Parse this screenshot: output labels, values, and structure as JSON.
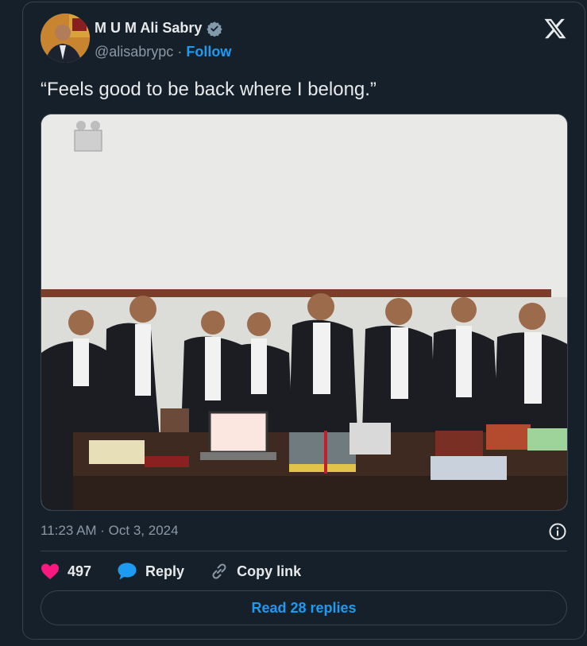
{
  "author": {
    "name": "M U M Ali Sabry",
    "handle": "@alisabrypc",
    "separator": "·",
    "follow_label": "Follow"
  },
  "tweet": {
    "text": "“Feels good to be back where I belong.”",
    "timestamp": "11:23 AM · Oct 3, 2024"
  },
  "actions": {
    "like_count": "497",
    "reply_label": "Reply",
    "copy_link_label": "Copy link"
  },
  "read_replies_label": "Read 28 replies",
  "icons": {
    "verified": "verified-badge-icon",
    "x_logo": "x-logo-icon",
    "info": "info-icon",
    "like": "heart-icon",
    "reply": "speech-bubble-icon",
    "copy_link": "link-icon"
  },
  "colors": {
    "background": "#15202b",
    "accent": "#1d9bf0",
    "like": "#f91880",
    "muted_text": "#8b98a5",
    "border": "#38444d"
  }
}
